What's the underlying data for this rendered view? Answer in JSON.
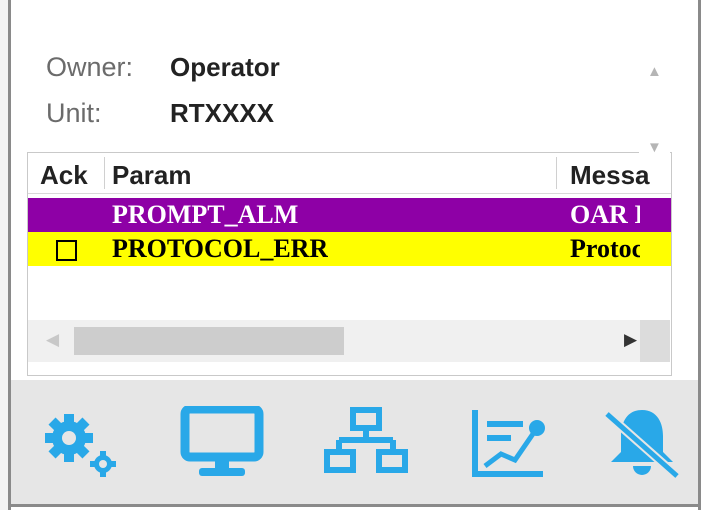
{
  "info": {
    "owner_label": "Owner:",
    "owner_value": "Operator",
    "unit_label": "Unit:",
    "unit_value": "RTXXXX"
  },
  "table": {
    "headers": {
      "ack": "Ack",
      "param": "Param",
      "message": "Messa"
    },
    "rows": [
      {
        "param": "PROMPT_ALM",
        "message": "OAR I",
        "ack": "",
        "color": "#8e00a6"
      },
      {
        "param": "PROTOCOL_ERR",
        "message": "Protoc",
        "ack": "unchecked",
        "color": "#ffff00"
      }
    ]
  },
  "toolbar": {
    "accent": "#29a8e8",
    "icons": [
      "settings-icon",
      "monitor-icon",
      "network-icon",
      "trend-icon",
      "bell-mute-icon"
    ]
  }
}
